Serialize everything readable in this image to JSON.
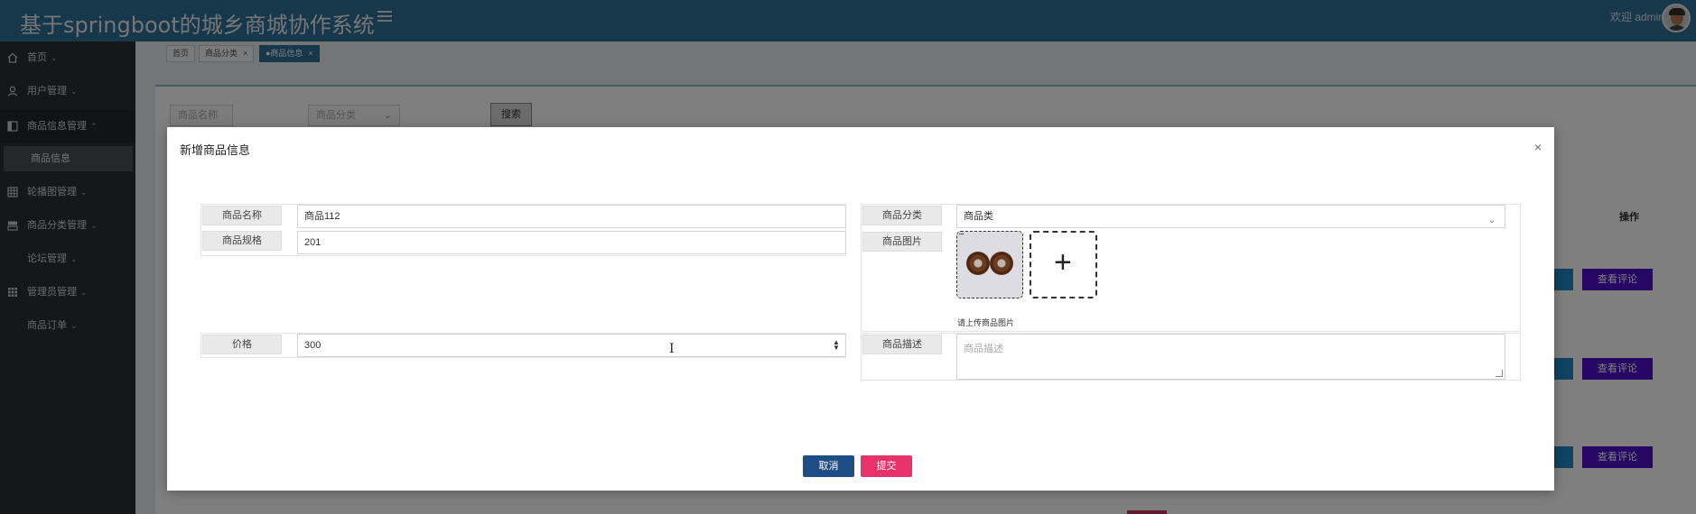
{
  "header": {
    "title": "基于springboot的城乡商城协作系统",
    "welcome": "欢迎 admin",
    "menu_icon": "hamburger-icon",
    "avatar_icon": "user-avatar"
  },
  "sidebar": {
    "items": [
      {
        "label": "首页",
        "icon": "home-icon"
      },
      {
        "label": "用户管理",
        "icon": "user-icon"
      },
      {
        "label": "商品信息管理",
        "icon": "grid-icon",
        "expanded": true
      },
      {
        "label": "轮播图管理",
        "icon": "table-icon"
      },
      {
        "label": "商品分类管理",
        "icon": "layers-icon"
      },
      {
        "label": "论坛管理",
        "icon": ""
      },
      {
        "label": "管理员管理",
        "icon": "apps-icon"
      },
      {
        "label": "商品订单",
        "icon": ""
      }
    ],
    "sub_item": "商品信息"
  },
  "tabs": [
    {
      "label": "首页"
    },
    {
      "label": "商品分类",
      "closable": true
    },
    {
      "label": "●商品信息",
      "closable": true,
      "active": true
    }
  ],
  "filters": {
    "name_placeholder": "商品名称",
    "category_placeholder": "商品分类",
    "search_button": "搜索"
  },
  "table": {
    "action_header": "操作",
    "comment_button": "查看评论"
  },
  "modal": {
    "title": "新增商品信息",
    "close": "×",
    "fields": {
      "name_label": "商品名称",
      "name_value": "商品112",
      "spec_label": "商品规格",
      "spec_value": "201",
      "category_label": "商品分类",
      "category_value": "商品类",
      "image_label": "商品图片",
      "image_hint": "请上传商品图片",
      "price_label": "价格",
      "price_value": "300",
      "desc_label": "商品描述",
      "desc_placeholder": "商品描述"
    },
    "cancel_button": "取消",
    "submit_button": "提交"
  },
  "colors": {
    "header": "#2f6f95",
    "sidebar": "#2a2e33",
    "cancel": "#1f4e86",
    "submit": "#e8326b",
    "comment": "#4d0fc6"
  }
}
